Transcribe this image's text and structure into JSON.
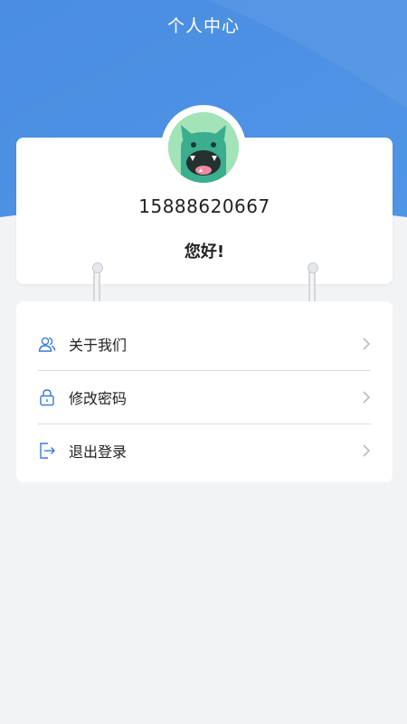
{
  "header": {
    "title": "个人中心"
  },
  "profile": {
    "phone": "15888620667",
    "greeting": "您好!",
    "avatar_icon": "monster-avatar-icon"
  },
  "menu": {
    "items": [
      {
        "label": "关于我们",
        "icon": "users-icon"
      },
      {
        "label": "修改密码",
        "icon": "lock-icon"
      },
      {
        "label": "退出登录",
        "icon": "logout-icon"
      }
    ]
  },
  "colors": {
    "header_blue": "#4a8fe3",
    "accent_icon": "#3a7bd5",
    "background": "#f2f3f5",
    "avatar_bg": "#9fe0b5"
  }
}
